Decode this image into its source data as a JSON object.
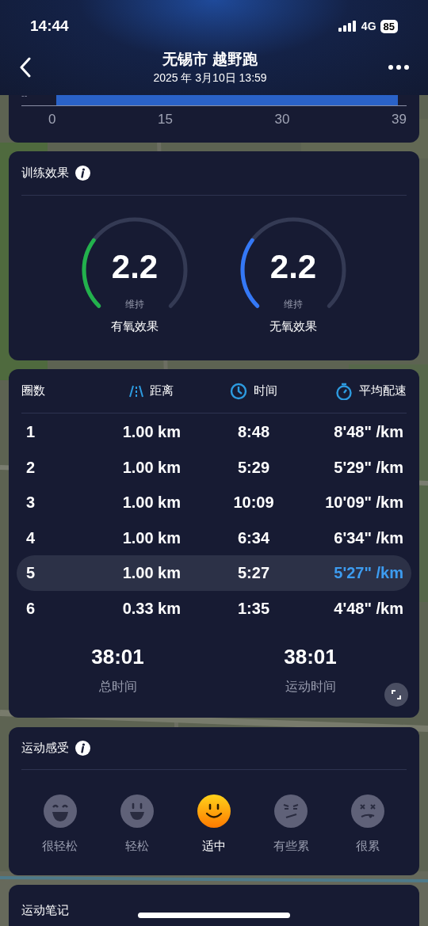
{
  "status_bar": {
    "time": "14:44",
    "network": "4G",
    "battery": "85"
  },
  "header": {
    "title": "无锡市 越野跑",
    "subtitle": "2025 年 3月10日 13:59"
  },
  "chart_fragment": {
    "y_label": "--",
    "x_labels": [
      "0",
      "15",
      "30",
      "39"
    ]
  },
  "training_effect": {
    "title": "训练效果",
    "gauges": [
      {
        "value": "2.2",
        "status": "维持",
        "label": "有氧效果",
        "color": "#22b24c"
      },
      {
        "value": "2.2",
        "status": "维持",
        "label": "无氧效果",
        "color": "#3478f6"
      }
    ]
  },
  "laps": {
    "columns": [
      {
        "kind": "plain",
        "label": "圈数"
      },
      {
        "kind": "road",
        "label": "距离"
      },
      {
        "kind": "clock",
        "label": "时间"
      },
      {
        "kind": "stopwatch",
        "label": "平均配速"
      }
    ],
    "rows": [
      {
        "lap": "1",
        "distance": "1.00 km",
        "time": "8:48",
        "pace": "8'48\" /km",
        "selected": false
      },
      {
        "lap": "2",
        "distance": "1.00 km",
        "time": "5:29",
        "pace": "5'29\" /km",
        "selected": false
      },
      {
        "lap": "3",
        "distance": "1.00 km",
        "time": "10:09",
        "pace": "10'09\" /km",
        "selected": false
      },
      {
        "lap": "4",
        "distance": "1.00 km",
        "time": "6:34",
        "pace": "6'34\" /km",
        "selected": false
      },
      {
        "lap": "5",
        "distance": "1.00 km",
        "time": "5:27",
        "pace": "5'27\" /km",
        "selected": true
      },
      {
        "lap": "6",
        "distance": "0.33 km",
        "time": "1:35",
        "pace": "4'48\" /km",
        "selected": false
      }
    ],
    "totals": [
      {
        "value": "38:01",
        "label": "总时间"
      },
      {
        "value": "38:01",
        "label": "运动时间"
      }
    ]
  },
  "feeling": {
    "title": "运动感受",
    "options": [
      {
        "kind": "laugh",
        "label": "很轻松",
        "selected": false
      },
      {
        "kind": "grin",
        "label": "轻松",
        "selected": false
      },
      {
        "kind": "smile",
        "label": "适中",
        "selected": true
      },
      {
        "kind": "tired",
        "label": "有些累",
        "selected": false
      },
      {
        "kind": "exhausted",
        "label": "很累",
        "selected": false
      }
    ]
  },
  "notes": {
    "title": "运动笔记"
  }
}
